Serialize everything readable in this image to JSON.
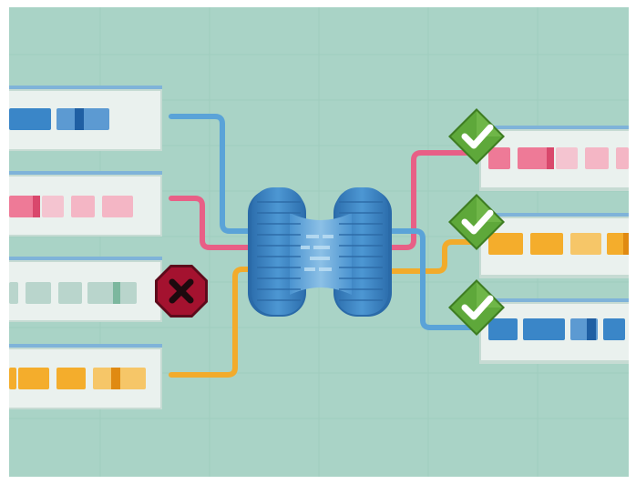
{
  "colors": {
    "background": "#a9d3c6",
    "grid": "#9ccabc",
    "card": "#eaf1ee",
    "card_shadow": "#c9dcd5",
    "card_top_strip": "#7fb3d9",
    "blue": "#3a86c8",
    "blue_dark": "#1f5fa3",
    "pink": "#ee7a97",
    "pink_light": "#f4b6c5",
    "pink_dark": "#d9486c",
    "gray": "#b9d5cc",
    "gray_dark": "#7cb79e",
    "orange": "#f4ad2c",
    "orange_light": "#f6c668",
    "orange_dark": "#e08a12",
    "connector_blue": "#5aa3d8",
    "connector_pink": "#e85f86",
    "connector_orange": "#f2ab2b",
    "hub": "#3d86c4",
    "hub_dark": "#2a6aa8",
    "check_badge": "#5ea83a",
    "reject_badge": "#a4122f"
  },
  "icons": {
    "hub": "data-pipeline-hub-icon",
    "accept": "checkmark-icon",
    "reject": "x-mark-icon"
  },
  "diagram": {
    "inputs": [
      {
        "id": "input-blue",
        "color": "blue",
        "status": "accepted"
      },
      {
        "id": "input-pink",
        "color": "pink",
        "status": "accepted"
      },
      {
        "id": "input-gray",
        "color": "gray",
        "status": "rejected"
      },
      {
        "id": "input-orange",
        "color": "orange",
        "status": "accepted"
      }
    ],
    "outputs": [
      {
        "id": "output-pink",
        "color": "pink",
        "badge": "check"
      },
      {
        "id": "output-orange",
        "color": "orange",
        "badge": "check"
      },
      {
        "id": "output-blue",
        "color": "blue",
        "badge": "check"
      }
    ]
  }
}
